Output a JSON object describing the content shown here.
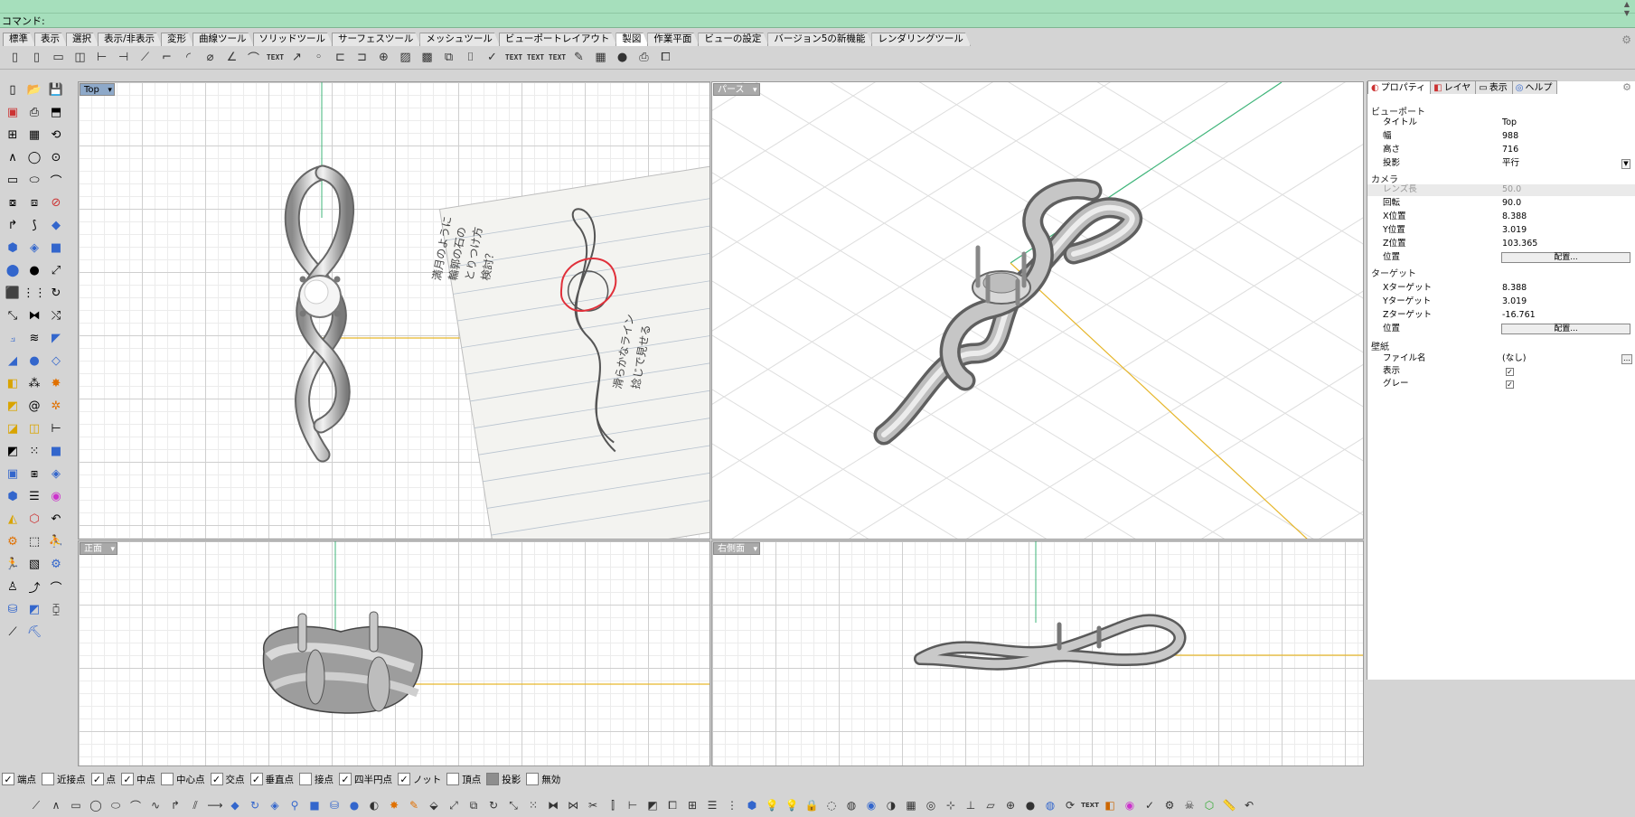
{
  "command": {
    "prompt": "コマンド:"
  },
  "toolbar_tabs": [
    "標準",
    "表示",
    "選択",
    "表示/非表示",
    "変形",
    "曲線ツール",
    "ソリッドツール",
    "サーフェスツール",
    "メッシュツール",
    "ビューポートレイアウト",
    "製図",
    "作業平面",
    "ビューの設定",
    "バージョン5の新機能",
    "レンダリングツール"
  ],
  "active_tab": "製図",
  "top_toolbar_text": {
    "text1": "TEXT",
    "text2": "TEXT",
    "text3": "TEXT",
    "text4": "TEXT"
  },
  "viewports": {
    "top": {
      "label": "Top"
    },
    "perspective": {
      "label": "パース"
    },
    "front": {
      "label": "正面"
    },
    "right": {
      "label": "右側面"
    }
  },
  "sketch_text": {
    "note1": "満月のように",
    "note2": "輪郭の石の",
    "note3": "とりつけ方",
    "note4": "検討？",
    "note5": "滑らかなライン",
    "note6": "捻じで見せる"
  },
  "properties": {
    "tabs": {
      "properties": "プロパティ",
      "layers": "レイヤ",
      "display": "表示",
      "help": "ヘルプ"
    },
    "viewport_section": "ビューポート",
    "title_label": "タイトル",
    "title_value": "Top",
    "width_label": "幅",
    "width_value": "988",
    "height_label": "高さ",
    "height_value": "716",
    "projection_label": "投影",
    "projection_value": "平行",
    "camera_section": "カメラ",
    "lens_label": "レンズ長",
    "lens_value": "50.0",
    "rotation_label": "回転",
    "rotation_value": "90.0",
    "xpos_label": "X位置",
    "xpos_value": "8.388",
    "ypos_label": "Y位置",
    "ypos_value": "3.019",
    "zpos_label": "Z位置",
    "zpos_value": "103.365",
    "position_label": "位置",
    "place_button": "配置...",
    "target_section": "ターゲット",
    "xtarget_label": "Xターゲット",
    "xtarget_value": "8.388",
    "ytarget_label": "Yターゲット",
    "ytarget_value": "3.019",
    "ztarget_label": "Zターゲット",
    "ztarget_value": "-16.761",
    "target_position_label": "位置",
    "target_place_button": "配置...",
    "wallpaper_section": "壁紙",
    "filename_label": "ファイル名",
    "filename_value": "(なし)",
    "show_label": "表示",
    "gray_label": "グレー"
  },
  "osnaps": [
    {
      "label": "端点",
      "checked": true
    },
    {
      "label": "近接点",
      "checked": false
    },
    {
      "label": "点",
      "checked": true
    },
    {
      "label": "中点",
      "checked": true
    },
    {
      "label": "中心点",
      "checked": false
    },
    {
      "label": "交点",
      "checked": true
    },
    {
      "label": "垂直点",
      "checked": true
    },
    {
      "label": "接点",
      "checked": false
    },
    {
      "label": "四半円点",
      "checked": true
    },
    {
      "label": "ノット",
      "checked": true
    },
    {
      "label": "頂点",
      "checked": false
    },
    {
      "label": "投影",
      "checked": false,
      "filled": true
    },
    {
      "label": "無効",
      "checked": false
    }
  ],
  "bottom_toolbar_text": {
    "text": "TEXT"
  },
  "colors": {
    "command_bg": "#a6dfbc",
    "axis_green": "#3fb57a",
    "axis_yellow": "#e6b62a",
    "active_label": "#8ea9c9"
  }
}
